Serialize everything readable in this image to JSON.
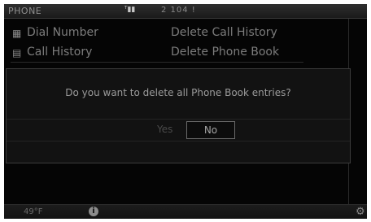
{
  "status_bar": {
    "title": "PHONE",
    "signal_text": "ᵀ▮▮",
    "info": "2 104 !"
  },
  "menu": {
    "items": [
      {
        "label": "Dial Number",
        "icon": "phone-keypad-icon",
        "glyph": "▦"
      },
      {
        "label": "Delete Call History"
      },
      {
        "label": "Call History",
        "icon": "call-list-icon",
        "glyph": "▤"
      },
      {
        "label": "Delete Phone Book"
      }
    ]
  },
  "dialog": {
    "message": "Do you want to delete all Phone Book entries?",
    "yes_label": "Yes",
    "no_label": "No"
  },
  "bottom_bar": {
    "temperature": "49°F",
    "info_glyph": "i",
    "gear_glyph": "⚙"
  }
}
